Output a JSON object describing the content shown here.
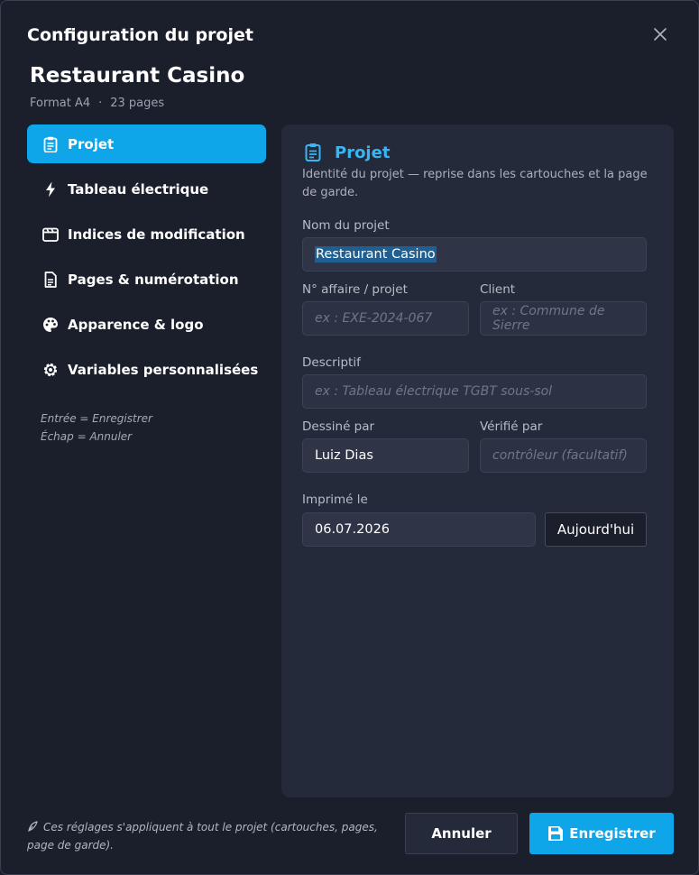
{
  "dialog": {
    "title": "Configuration du projet",
    "close_icon": "close-icon"
  },
  "project": {
    "name": "Restaurant Casino",
    "format": "Format A4",
    "separator": "·",
    "pages": "23 pages"
  },
  "sidebar": {
    "items": [
      {
        "label": "Projet",
        "icon": "clipboard-icon",
        "active": true
      },
      {
        "label": "Tableau électrique",
        "icon": "bolt-icon",
        "active": false
      },
      {
        "label": "Indices de modification",
        "icon": "clapperboard-icon",
        "active": false
      },
      {
        "label": "Pages & numérotation",
        "icon": "document-icon",
        "active": false
      },
      {
        "label": "Apparence & logo",
        "icon": "palette-icon",
        "active": false
      },
      {
        "label": "Variables personnalisées",
        "icon": "gear-icon",
        "active": false
      }
    ],
    "hint_enter": "Entrée = Enregistrer",
    "hint_escape": "Échap = Annuler"
  },
  "panel": {
    "title": "Projet",
    "description": "Identité du projet — reprise dans les cartouches et la page de garde.",
    "fields": {
      "project_name": {
        "label": "Nom du projet",
        "value": "Restaurant Casino"
      },
      "job_number": {
        "label": "N° affaire / projet",
        "value": "",
        "placeholder": "ex : EXE-2024-067"
      },
      "client": {
        "label": "Client",
        "value": "",
        "placeholder": "ex : Commune de Sierre"
      },
      "description": {
        "label": "Descriptif",
        "value": "",
        "placeholder": "ex : Tableau électrique TGBT sous-sol"
      },
      "drawn_by": {
        "label": "Dessiné par",
        "value": "Luiz Dias"
      },
      "checked_by": {
        "label": "Vérifié par",
        "value": "",
        "placeholder": "contrôleur (facultatif)"
      },
      "printed_on": {
        "label": "Imprimé le",
        "value": "06.07.2026"
      }
    },
    "today_button": "Aujourd'hui"
  },
  "footer": {
    "note": "Ces réglages s'appliquent à tout le projet (cartouches, pages, page de garde).",
    "cancel_label": "Annuler",
    "save_label": "Enregistrer"
  },
  "colors": {
    "accent": "#0ea5e9",
    "accent_text": "#38b6f4",
    "background": "#1b1f2c",
    "panel": "#252a3a"
  }
}
